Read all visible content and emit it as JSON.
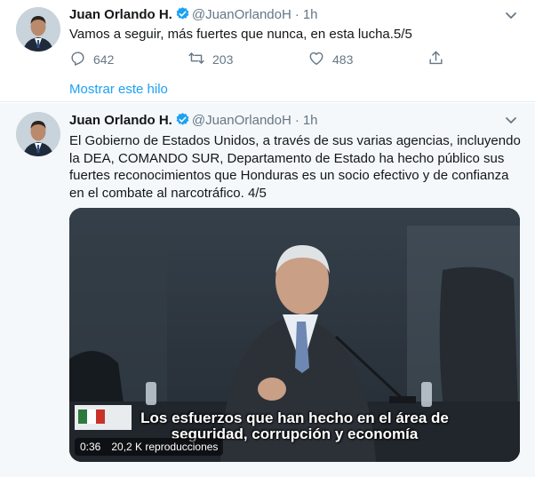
{
  "tweets": [
    {
      "name": "Juan Orlando H.",
      "handle": "@JuanOrlandoH",
      "dot": "·",
      "time": "1h",
      "text": "Vamos a seguir, más fuertes que nunca, en esta lucha.5/5",
      "replies": "642",
      "retweets": "203",
      "likes": "483",
      "thread_link": "Mostrar este hilo"
    },
    {
      "name": "Juan Orlando H.",
      "handle": "@JuanOrlandoH",
      "dot": "·",
      "time": "1h",
      "text_lines": [
        "El Gobierno de Estados Unidos, a través de  sus varias  agencias, incluyendo",
        "la DEA, COMANDO SUR, Departamento de Estado ha hecho público sus",
        "fuertes reconocimientos que Honduras es un socio efectivo y de confianza",
        "en el combate al narcotráfico. 4/5"
      ],
      "video": {
        "subtitle_line1": "Los esfuerzos que han hecho en el área de",
        "subtitle_line2": "seguridad, corrupción y economía",
        "duration": "0:36",
        "views": "20,2 K reproducciones"
      }
    }
  ],
  "colors": {
    "accent": "#1da1f2",
    "secondary_text": "#657786",
    "thread_background": "#f5f8fa",
    "divider": "#e6ecf0"
  },
  "icons": [
    "verified-badge-icon",
    "chevron-down-icon",
    "reply-icon",
    "retweet-icon",
    "like-heart-icon",
    "share-icon"
  ]
}
